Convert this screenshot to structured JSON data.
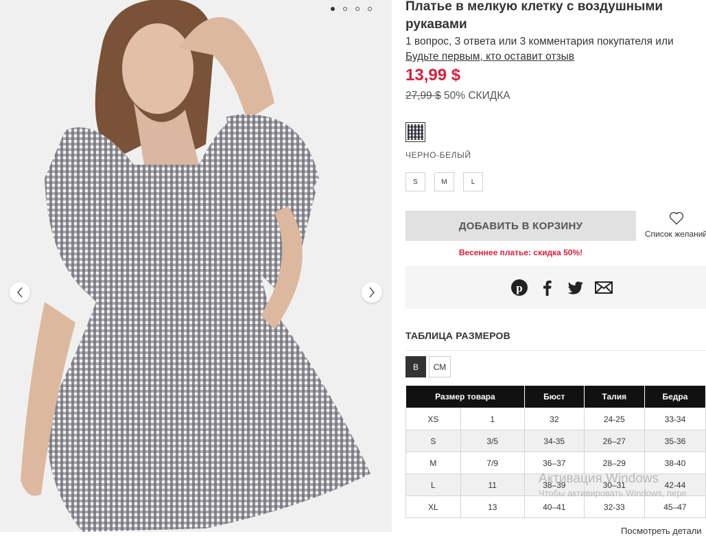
{
  "product": {
    "title": "Платье в мелкую клетку с воздушными рукавами",
    "reviews_text": "1 вопрос, 3 ответа или 3 комментария покупателя или",
    "review_link": "Будьте первым, кто оставит отзыв",
    "price": "13,99 $",
    "old_price": "27,99 $",
    "discount": "50% СКИДКА",
    "color_name": "ЧЕРНО-БЕЛЫЙ",
    "sizes": [
      "S",
      "M",
      "L"
    ],
    "add_to_cart": "ДОБАВИТЬ В КОРЗИНУ",
    "wishlist": "Список желаний",
    "promo": "Весеннее платье: скидка 50%!"
  },
  "gallery": {
    "slides": 4,
    "active": 0
  },
  "share": {
    "icons": [
      "pinterest-icon",
      "facebook-icon",
      "twitter-icon",
      "email-icon"
    ]
  },
  "size_chart": {
    "title": "ТАБЛИЦА РАЗМЕРОВ",
    "units": [
      "В",
      "СМ"
    ],
    "active_unit": "В",
    "headers": [
      "Размер товара",
      "Бюст",
      "Талия",
      "Бедра"
    ],
    "rows": [
      [
        "XS",
        "1",
        "32",
        "24-25",
        "33-34"
      ],
      [
        "S",
        "3/5",
        "34-35",
        "26–27",
        "35-36"
      ],
      [
        "M",
        "7/9",
        "36–37",
        "28–29",
        "38-40"
      ],
      [
        "L",
        "11",
        "38–39",
        "30–31",
        "42-44"
      ],
      [
        "XL",
        "13",
        "40–41",
        "32-33",
        "45–47"
      ]
    ]
  },
  "watermark": {
    "line1": "Активация Windows",
    "line2": "Чтобы активировать Windows, пере"
  },
  "footer_link": "Посмотреть детали",
  "colors": {
    "accent": "#d6203d",
    "dark": "#111111",
    "button_bg": "#e1e1e1"
  }
}
